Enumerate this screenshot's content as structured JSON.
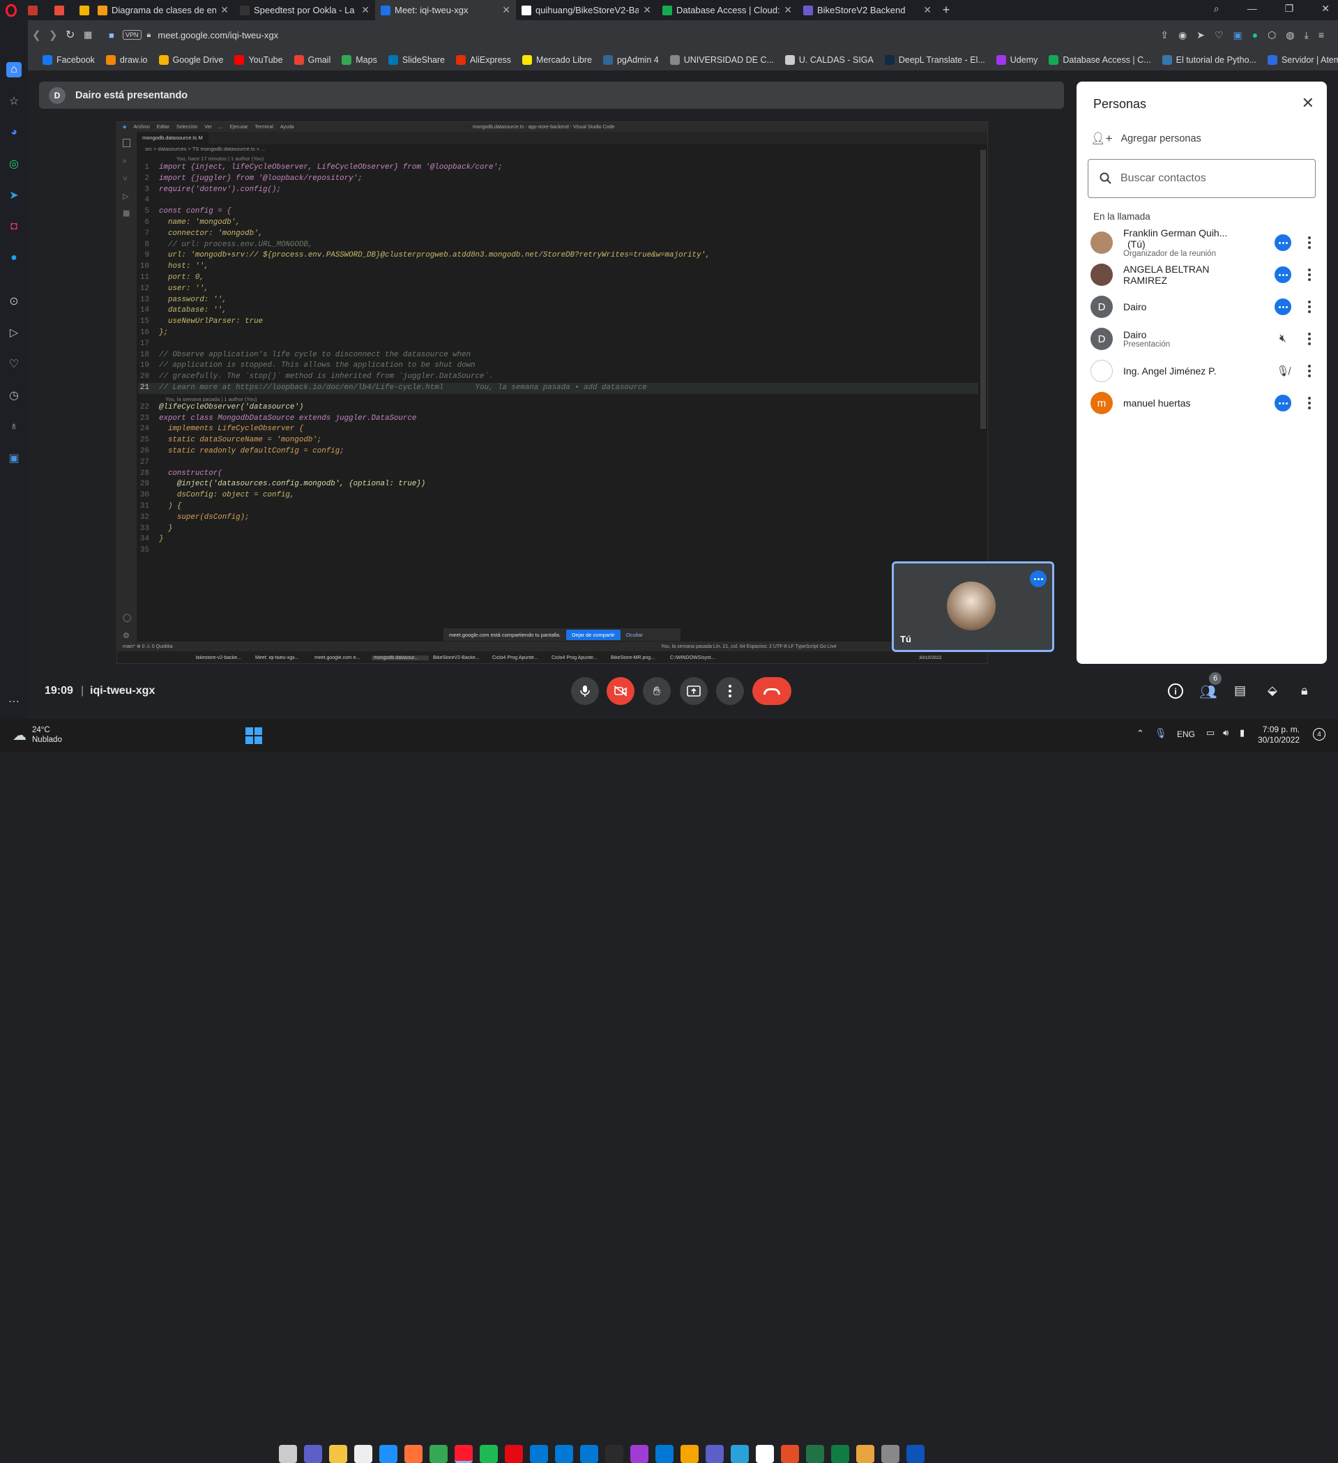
{
  "tabs": [
    {
      "label": "",
      "color": "#c0392b"
    },
    {
      "label": "",
      "color": "#e74c3c"
    },
    {
      "label": "",
      "color": "#f4b400"
    },
    {
      "label": "Diagrama de clases de ent",
      "color": "#f39c12"
    },
    {
      "label": "Speedtest por Ookla - La p",
      "color": "#333"
    },
    {
      "label": "Meet: iqi-tweu-xgx",
      "color": "#1a73e8",
      "active": true
    },
    {
      "label": "quihuang/BikeStoreV2-Bac",
      "color": "#fff"
    },
    {
      "label": "Database Access | Cloud: M",
      "color": "#13aa52"
    },
    {
      "label": "BikeStoreV2 Backend",
      "color": "#6a5acd"
    }
  ],
  "new_tab_label": "+",
  "url": "meet.google.com/iqi-tweu-xgx",
  "vpn_label": "VPN",
  "bookmarks": [
    {
      "label": "Facebook",
      "color": "#1877f2"
    },
    {
      "label": "draw.io",
      "color": "#f08705"
    },
    {
      "label": "Google Drive",
      "color": "#f4b400"
    },
    {
      "label": "YouTube",
      "color": "#ff0000"
    },
    {
      "label": "Gmail",
      "color": "#ea4335"
    },
    {
      "label": "Maps",
      "color": "#34a853"
    },
    {
      "label": "SlideShare",
      "color": "#0077b5"
    },
    {
      "label": "AliExpress",
      "color": "#e62e04"
    },
    {
      "label": "Mercado Libre",
      "color": "#ffe600"
    },
    {
      "label": "pgAdmin 4",
      "color": "#336791"
    },
    {
      "label": "UNIVERSIDAD DE C...",
      "color": "#888"
    },
    {
      "label": "U. CALDAS - SIGA",
      "color": "#ccc"
    },
    {
      "label": "DeepL Translate - El...",
      "color": "#0f2b46"
    },
    {
      "label": "Udemy",
      "color": "#a435f0"
    },
    {
      "label": "Database Access | C...",
      "color": "#13aa52"
    },
    {
      "label": "El tutorial de Pytho...",
      "color": "#3776ab"
    },
    {
      "label": "Servidor | Atemos |...",
      "color": "#2d6cdf"
    }
  ],
  "banner": {
    "avatar": "D",
    "text": "Dairo está presentando"
  },
  "vscode": {
    "menu": [
      "Archivo",
      "Editar",
      "Selección",
      "Ver",
      "...",
      "Ejecutar",
      "Terminal",
      "Ayuda"
    ],
    "window_title": "mongodb.datasource.ts - app-store-backend - Visual Studio Code",
    "tab": "mongodb.datasource.ts M",
    "breadcrumb": "src > datasources > TS mongodb.datasource.ts > ...",
    "blame_top": "You, hace 17 minutos | 1 author (You)",
    "blame_mid": "You, la semana pasada | 1 author (You)",
    "lines": [
      "import {inject, lifeCycleObserver, LifeCycleObserver} from '@loopback/core';",
      "import {juggler} from '@loopback/repository';",
      "require('dotenv').config();",
      "",
      "const config = {",
      "  name: 'mongodb',",
      "  connector: 'mongodb',",
      "  // url: process.env.URL_MONGODB,",
      "  url: 'mongodb+srv:// ${process.env.PASSWORD_DB}@clusterprogweb.atdd8n3.mongodb.net/StoreDB?retryWrites=true&w=majority',",
      "  host: '',",
      "  port: 0,",
      "  user: '',",
      "  password: '',",
      "  database: '',",
      "  useNewUrlParser: true",
      "};",
      "",
      "// Observe application's life cycle to disconnect the datasource when",
      "// application is stopped. This allows the application to be shut down",
      "// gracefully. The `stop()` method is inherited from `juggler.DataSource`.",
      "// Learn more at https://loopback.io/doc/en/lb4/Life-cycle.html       You, la semana pasada • add datasource",
      "@lifeCycleObserver('datasource')",
      "export class MongodbDataSource extends juggler.DataSource",
      "  implements LifeCycleObserver {",
      "  static dataSourceName = 'mongodb';",
      "  static readonly defaultConfig = config;",
      "",
      "  constructor(",
      "    @inject('datasources.config.mongodb', {optional: true})",
      "    dsConfig: object = config,",
      "  ) {",
      "    super(dsConfig);",
      "  }",
      "}",
      ""
    ],
    "statusbar": "main*   ⊗ 0 ⚠ 0   Quokka",
    "statusbar_right": "You, la semana pasada   Lín. 21, col. 64   Espacios: 2   UTF-8   LF   TypeScript   Go Live",
    "share_notice": "meet.google.com está compartiendo tu pantalla.",
    "stop_share": "Dejar de compartir",
    "hide": "Ocultar",
    "inner_taskbar": [
      "bikestore-v2-backe...",
      "Meet: iqi-tweu-xgx...",
      "meet.google.com e...",
      "mongodb.datasour...",
      "BikeStoreV2-Backe...",
      "Ciclo4 Prog Apunte...",
      "Ciclo4 Prog Apunte...",
      "BikeStore-MR.png...",
      "C:\\WINDOWS\\syst..."
    ],
    "inner_clock": "30/10/2022"
  },
  "self_tile": {
    "label": "Tú"
  },
  "panel": {
    "title": "Personas",
    "add_people": "Agregar personas",
    "search_placeholder": "Buscar contactos",
    "section": "En la llamada",
    "people": [
      {
        "name": "Franklin German Quih...",
        "tag": "(Tú)",
        "sub": "Organizador de la reunión",
        "avatar": "",
        "avatar_color": "#b08968",
        "status": "audio"
      },
      {
        "name": "ANGELA BELTRAN RAMIREZ",
        "sub": "",
        "avatar": "",
        "avatar_color": "#6d4c41",
        "status": "audio"
      },
      {
        "name": "Dairo",
        "sub": "",
        "avatar": "D",
        "avatar_color": "#5f6368",
        "status": "audio"
      },
      {
        "name": "Dairo",
        "sub": "Presentación",
        "avatar": "D",
        "avatar_color": "#5f6368",
        "status": "muted-speaker"
      },
      {
        "name": "Ing. Angel Jiménez P.",
        "sub": "",
        "avatar": "",
        "avatar_color": "#ffffff",
        "status": "mic-off"
      },
      {
        "name": "manuel huertas",
        "sub": "",
        "avatar": "m",
        "avatar_color": "#e8710a",
        "status": "audio"
      }
    ]
  },
  "bottom": {
    "time": "19:09",
    "separator": "|",
    "meeting_code": "iqi-tweu-xgx",
    "people_count": "6"
  },
  "taskbar": {
    "weather_temp": "24°C",
    "weather_text": "Nublado",
    "lang": "ENG",
    "time": "7:09 p. m.",
    "date": "30/10/2022",
    "notif": "4"
  }
}
